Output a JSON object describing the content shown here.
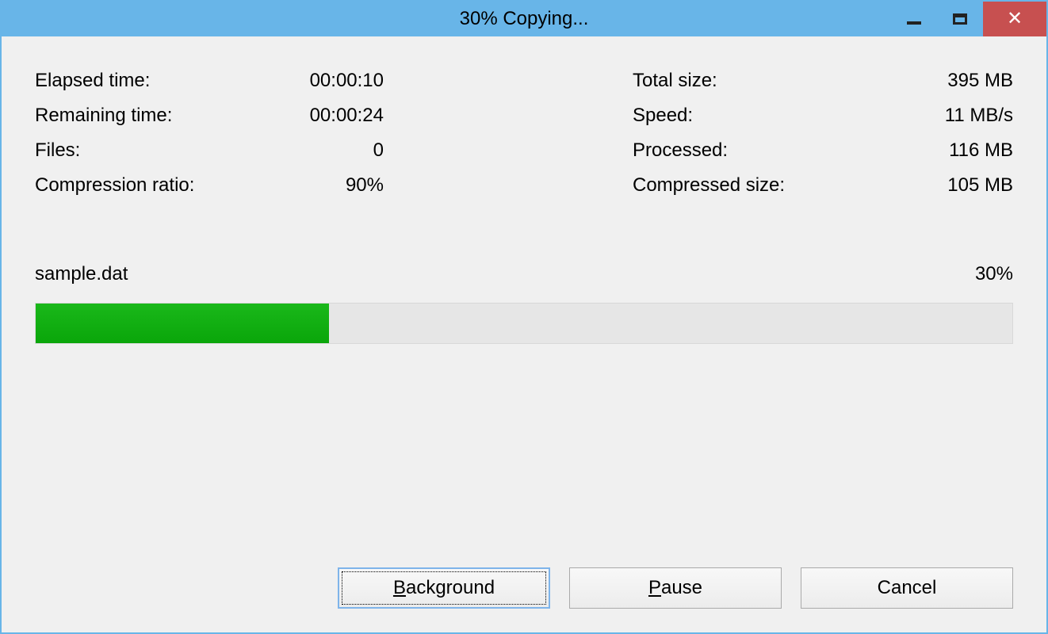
{
  "titlebar": {
    "title": "30% Copying..."
  },
  "stats": {
    "elapsed_label": "Elapsed time:",
    "elapsed_value": "00:00:10",
    "remaining_label": "Remaining time:",
    "remaining_value": "00:00:24",
    "files_label": "Files:",
    "files_value": "0",
    "ratio_label": "Compression ratio:",
    "ratio_value": "90%",
    "total_label": "Total size:",
    "total_value": "395 MB",
    "speed_label": "Speed:",
    "speed_value": "11 MB/s",
    "processed_label": "Processed:",
    "processed_value": "116 MB",
    "compressed_label": "Compressed size:",
    "compressed_value": "105 MB"
  },
  "file": {
    "name": "sample.dat",
    "percent_text": "30%",
    "percent_value": 30
  },
  "buttons": {
    "background": "Background",
    "pause": "Pause",
    "cancel": "Cancel"
  },
  "colors": {
    "titlebar": "#68b5e8",
    "close": "#c75050",
    "progress": "#0cad0c"
  }
}
